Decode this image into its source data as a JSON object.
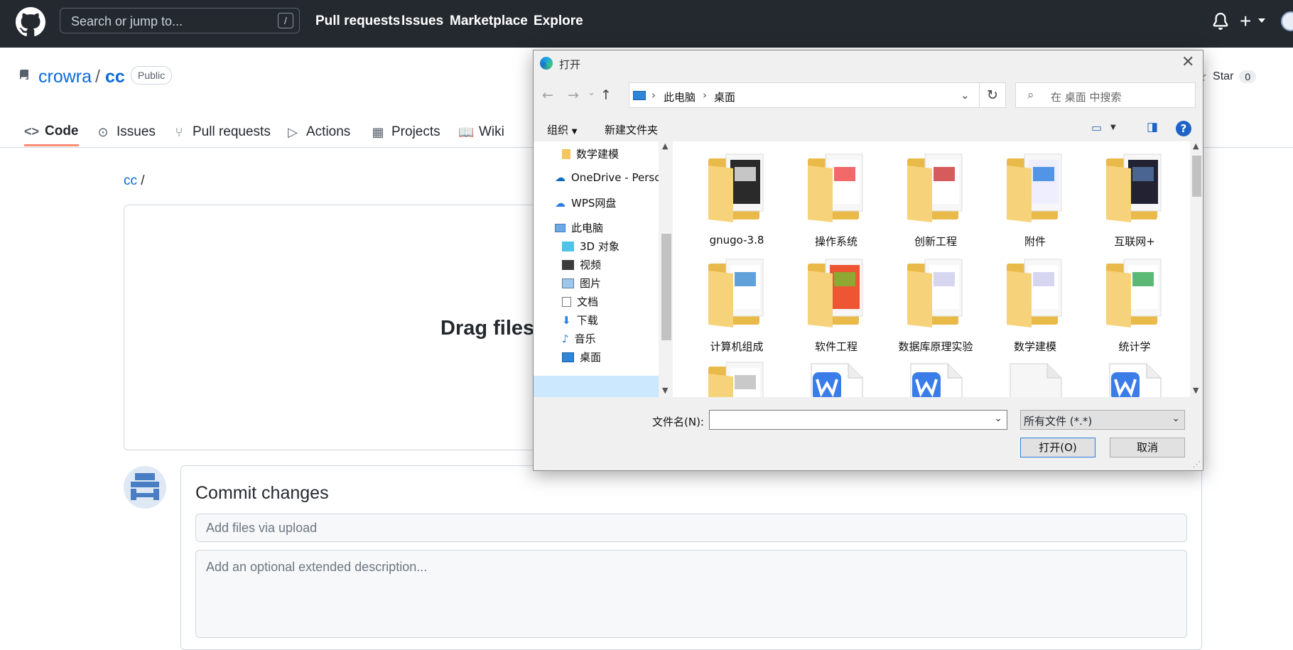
{
  "header": {
    "search_placeholder": "Search or jump to...",
    "search_shortcut": "/",
    "nav": [
      "Pull requests",
      "Issues",
      "Marketplace",
      "Explore"
    ]
  },
  "repo": {
    "owner": "crowra",
    "separator": "/",
    "name": "cc",
    "visibility": "Public",
    "star_label": "Star",
    "star_count": "0"
  },
  "tabs": [
    {
      "label": "Code",
      "icon": "code-icon"
    },
    {
      "label": "Issues",
      "icon": "issue-icon"
    },
    {
      "label": "Pull requests",
      "icon": "pull-request-icon"
    },
    {
      "label": "Actions",
      "icon": "play-icon"
    },
    {
      "label": "Projects",
      "icon": "table-icon"
    },
    {
      "label": "Wiki",
      "icon": "book-icon"
    }
  ],
  "upload": {
    "breadcrumb_repo": "cc",
    "breadcrumb_sep": "/",
    "drag_text": "Drag files"
  },
  "commit": {
    "title": "Commit changes",
    "summary_placeholder": "Add files via upload",
    "description_placeholder": "Add an optional extended description..."
  },
  "dialog": {
    "title": "打开",
    "address": [
      "此电脑",
      "桌面"
    ],
    "search_placeholder": "在 桌面 中搜索",
    "toolbar": {
      "organize": "组织",
      "new_folder": "新建文件夹"
    },
    "tree": [
      {
        "label": "数学建模",
        "icon": "folder-icon"
      },
      {
        "label": "OneDrive - Persc",
        "icon": "onedrive-icon"
      },
      {
        "label": "WPS网盘",
        "icon": "cloud-icon"
      },
      {
        "label": "此电脑",
        "icon": "computer-icon"
      },
      {
        "label": "3D 对象",
        "icon": "cube-icon"
      },
      {
        "label": "视频",
        "icon": "video-icon"
      },
      {
        "label": "图片",
        "icon": "picture-icon"
      },
      {
        "label": "文档",
        "icon": "document-icon"
      },
      {
        "label": "下载",
        "icon": "download-icon"
      },
      {
        "label": "音乐",
        "icon": "music-icon"
      },
      {
        "label": "桌面",
        "icon": "desktop-icon"
      }
    ],
    "files": [
      {
        "label": "gnugo-3.8",
        "kind": "folder"
      },
      {
        "label": "操作系统",
        "kind": "folder"
      },
      {
        "label": "创新工程",
        "kind": "folder"
      },
      {
        "label": "附件",
        "kind": "folder"
      },
      {
        "label": "互联网+",
        "kind": "folder"
      },
      {
        "label": "计算机组成",
        "kind": "folder"
      },
      {
        "label": "软件工程",
        "kind": "folder"
      },
      {
        "label": "数据库原理实验",
        "kind": "folder"
      },
      {
        "label": "数学建模",
        "kind": "folder"
      },
      {
        "label": "统计学",
        "kind": "folder"
      },
      {
        "label": "",
        "kind": "folder"
      },
      {
        "label": "",
        "kind": "wps-doc"
      },
      {
        "label": "",
        "kind": "wps-doc"
      },
      {
        "label": "",
        "kind": "blank-doc"
      },
      {
        "label": "",
        "kind": "wps-doc"
      }
    ],
    "filename_label": "文件名(N):",
    "filename_value": "",
    "filetype": "所有文件 (*.*)",
    "open_label": "打开(O)",
    "cancel_label": "取消"
  }
}
